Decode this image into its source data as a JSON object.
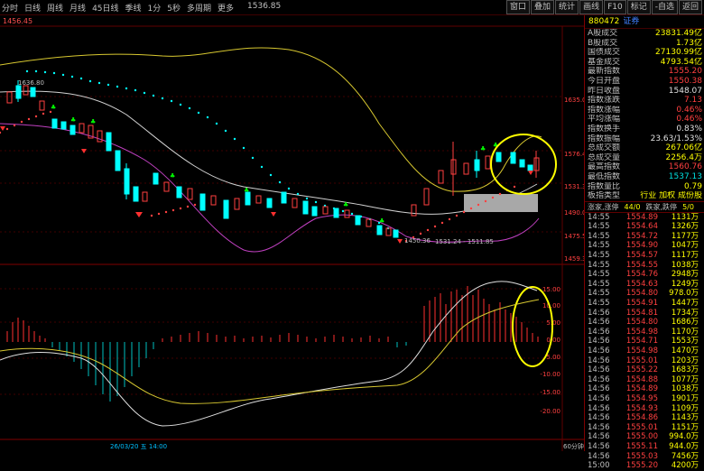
{
  "toolbar": {
    "items": [
      "分时",
      "日线",
      "周线",
      "月线",
      "45日线",
      "季线",
      "1分",
      "5秒",
      "多周期",
      "更多"
    ],
    "header_price": "1536.85",
    "right_buttons": [
      "窗口",
      "叠加",
      "统计",
      "画线",
      "F10",
      "标记",
      "-自选",
      "返回"
    ]
  },
  "chart_header": {
    "level_label": "1456.45"
  },
  "annotations": {
    "high_label": "1636.80",
    "channel_label": "1531.24 - 1511.85",
    "low_label": "1450.36",
    "time_label": "26/03/20 五 14:00",
    "period_label": "60分钟"
  },
  "price_axis": [
    "1635.09",
    "1576.48",
    "1531.38",
    "1490.00",
    "1475.55",
    "1459.35"
  ],
  "macd_axis": [
    "15.00",
    "10.00",
    "5.00",
    "0.00",
    "-5.00",
    "-10.00",
    "-15.00",
    "-20.00"
  ],
  "right_panel": {
    "code": "880472",
    "name": "证券",
    "stats": [
      {
        "k": "A股成交",
        "v": "23831.49亿",
        "c": "yellow"
      },
      {
        "k": "B股成交",
        "v": "1.73亿",
        "c": "yellow"
      },
      {
        "k": "国债成交",
        "v": "27130.99亿",
        "c": "yellow"
      },
      {
        "k": "基金成交",
        "v": "4793.54亿",
        "c": "yellow"
      },
      {
        "k": "最新指数",
        "v": "1555.20",
        "c": "red"
      },
      {
        "k": "今日开盘",
        "v": "1550.38",
        "c": "red"
      },
      {
        "k": "昨日收盘",
        "v": "1548.07",
        "c": "white"
      },
      {
        "k": "指数涨跌",
        "v": "7.13",
        "c": "red"
      },
      {
        "k": "指数涨幅",
        "v": "0.46%",
        "c": "red"
      },
      {
        "k": "平均涨幅",
        "v": "0.46%",
        "c": "red"
      },
      {
        "k": "指数换手",
        "v": "0.83%",
        "c": "white"
      },
      {
        "k": "指数振幅",
        "v": "23.63/1.53%",
        "c": "white"
      },
      {
        "k": "总成交额",
        "v": "267.06亿",
        "c": "yellow"
      },
      {
        "k": "总成交量",
        "v": "2256.4万",
        "c": "yellow"
      },
      {
        "k": "最高指数",
        "v": "1560.76",
        "c": "red"
      },
      {
        "k": "最低指数",
        "v": "1537.13",
        "c": "cyan"
      },
      {
        "k": "指数量比",
        "v": "0.79",
        "c": "yellow"
      },
      {
        "k": "板指类型",
        "v": "行业 加权 成份股",
        "c": "yellow"
      }
    ],
    "tabs": [
      "涨家,涨停",
      "44/0",
      "跌家,跌停",
      "5/0"
    ],
    "ticks": [
      {
        "t": "14:55",
        "p": "1554.89",
        "v": "1131万"
      },
      {
        "t": "14:55",
        "p": "1554.64",
        "v": "1326万"
      },
      {
        "t": "14:55",
        "p": "1554.72",
        "v": "1177万"
      },
      {
        "t": "14:55",
        "p": "1554.90",
        "v": "1047万"
      },
      {
        "t": "14:55",
        "p": "1554.57",
        "v": "1117万"
      },
      {
        "t": "14:55",
        "p": "1554.55",
        "v": "1038万"
      },
      {
        "t": "14:55",
        "p": "1554.76",
        "v": "2948万"
      },
      {
        "t": "14:55",
        "p": "1554.63",
        "v": "1249万"
      },
      {
        "t": "14:55",
        "p": "1554.80",
        "v": "978.0万"
      },
      {
        "t": "14:55",
        "p": "1554.91",
        "v": "1447万"
      },
      {
        "t": "14:56",
        "p": "1554.81",
        "v": "1734万"
      },
      {
        "t": "14:56",
        "p": "1554.80",
        "v": "1686万"
      },
      {
        "t": "14:56",
        "p": "1554.98",
        "v": "1170万"
      },
      {
        "t": "14:56",
        "p": "1554.71",
        "v": "1553万"
      },
      {
        "t": "14:56",
        "p": "1554.98",
        "v": "1470万"
      },
      {
        "t": "14:56",
        "p": "1555.01",
        "v": "1203万"
      },
      {
        "t": "14:56",
        "p": "1555.22",
        "v": "1683万"
      },
      {
        "t": "14:56",
        "p": "1554.88",
        "v": "1077万"
      },
      {
        "t": "14:56",
        "p": "1554.89",
        "v": "1038万"
      },
      {
        "t": "14:56",
        "p": "1554.95",
        "v": "1901万"
      },
      {
        "t": "14:56",
        "p": "1554.93",
        "v": "1109万"
      },
      {
        "t": "14:56",
        "p": "1554.86",
        "v": "1143万"
      },
      {
        "t": "14:56",
        "p": "1555.01",
        "v": "1151万"
      },
      {
        "t": "14:56",
        "p": "1555.00",
        "v": "994.0万"
      },
      {
        "t": "14:56",
        "p": "1555.11",
        "v": "944.0万"
      },
      {
        "t": "14:56",
        "p": "1555.03",
        "v": "7456万"
      },
      {
        "t": "15:00",
        "p": "1555.20",
        "v": "4200万"
      }
    ]
  }
}
